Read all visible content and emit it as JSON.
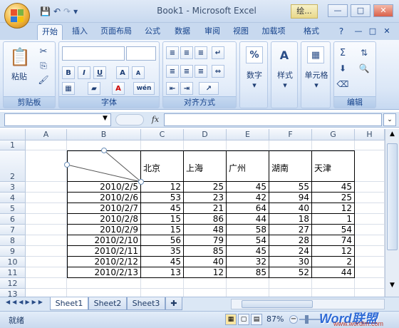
{
  "app": {
    "title": "Book1 - Microsoft Excel",
    "context_tab": "绘...",
    "window_buttons": [
      "—",
      "□",
      "✕"
    ]
  },
  "quick_access": {
    "save": "💾",
    "undo": "↶",
    "redo": "↷",
    "more": "▾"
  },
  "tabs": [
    "开始",
    "插入",
    "页面布局",
    "公式",
    "数据",
    "审阅",
    "视图",
    "加载项",
    "格式"
  ],
  "active_tab": "开始",
  "ribbon": {
    "clipboard": {
      "paste_label": "粘贴",
      "group_label": "剪贴板"
    },
    "font": {
      "bold": "B",
      "italic": "I",
      "underline": "U",
      "grow": "A",
      "shrink": "A",
      "wen": "wén",
      "group_label": "字体"
    },
    "alignment": {
      "group_label": "对齐方式"
    },
    "number": {
      "label": "数字",
      "icon": "%"
    },
    "styles": {
      "label": "样式"
    },
    "cells": {
      "label": "单元格"
    },
    "editing": {
      "group_label": "编辑",
      "sum": "Σ"
    }
  },
  "formula_bar": {
    "name_box": "",
    "fx": "fx",
    "content": ""
  },
  "columns": [
    "A",
    "B",
    "C",
    "D",
    "E",
    "F",
    "G",
    "H"
  ],
  "rows": [
    "1",
    "2",
    "3",
    "4",
    "5",
    "6",
    "7",
    "8",
    "9",
    "10",
    "11",
    "12",
    "13"
  ],
  "table": {
    "headers": [
      "北京",
      "上海",
      "广州",
      "湖南",
      "天津"
    ],
    "data": [
      [
        "2010/2/5",
        "12",
        "25",
        "45",
        "55",
        "45"
      ],
      [
        "2010/2/6",
        "53",
        "23",
        "42",
        "94",
        "25"
      ],
      [
        "2010/2/7",
        "45",
        "21",
        "64",
        "40",
        "12"
      ],
      [
        "2010/2/8",
        "15",
        "86",
        "44",
        "18",
        "1"
      ],
      [
        "2010/2/9",
        "15",
        "48",
        "58",
        "27",
        "54"
      ],
      [
        "2010/2/10",
        "56",
        "79",
        "54",
        "28",
        "74"
      ],
      [
        "2010/2/11",
        "35",
        "85",
        "45",
        "24",
        "12"
      ],
      [
        "2010/2/12",
        "45",
        "40",
        "32",
        "30",
        "2"
      ],
      [
        "2010/2/13",
        "13",
        "12",
        "85",
        "52",
        "44"
      ]
    ]
  },
  "sheets": [
    "Sheet1",
    "Sheet2",
    "Sheet3"
  ],
  "active_sheet": "Sheet1",
  "status": {
    "mode": "就绪",
    "zoom": "87%"
  },
  "watermark": {
    "brand": "Word联盟",
    "url": "www.wordlm.com"
  }
}
